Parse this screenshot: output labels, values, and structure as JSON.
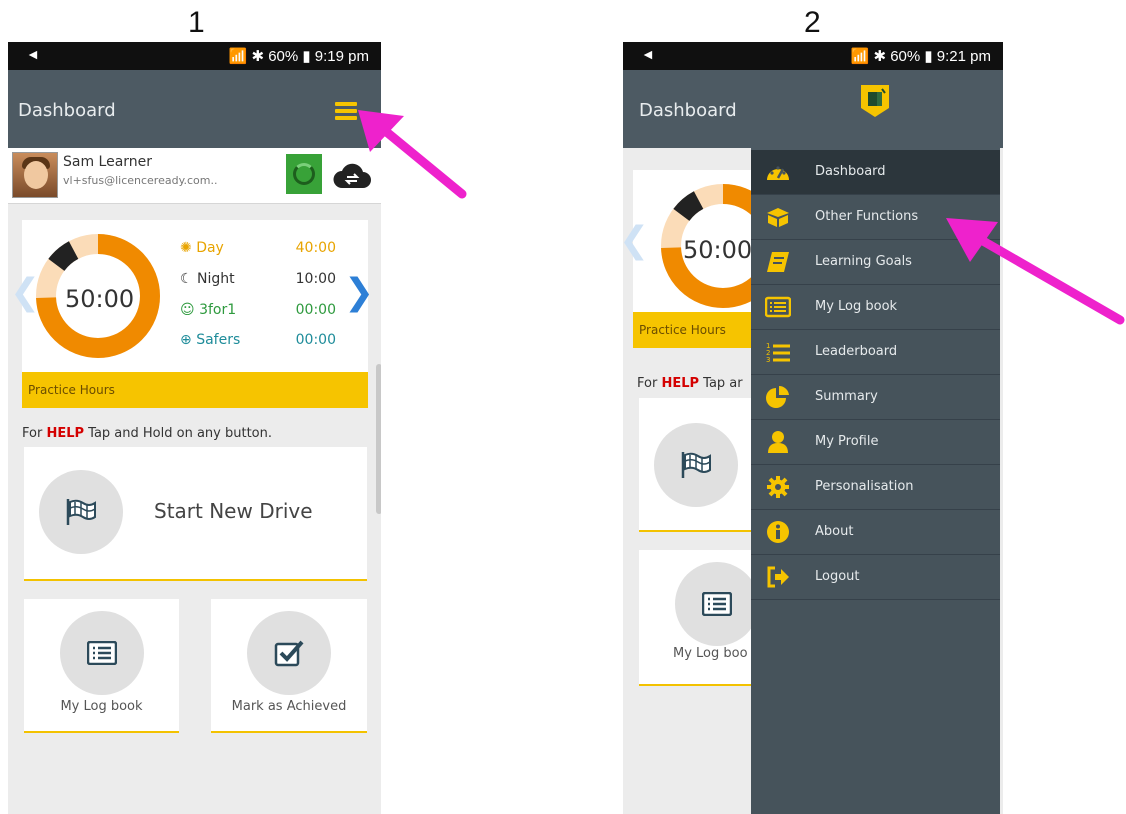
{
  "steps": {
    "first": "1",
    "second": "2"
  },
  "status_bar": {
    "left": "◄",
    "screen1_right": "📶 ✱ 60% ▮ 9:19 pm",
    "screen2_right": "📶 ✱ 60% ▮ 9:21 pm"
  },
  "header": {
    "title": "Dashboard"
  },
  "user": {
    "name": "Sam Learner",
    "email": "vl+sfus@licenceready.com.."
  },
  "hours": {
    "total": "50:00",
    "day_label": "Day",
    "day_value": "40:00",
    "night_label": "Night",
    "night_value": "10:00",
    "threefor1_label": "3for1",
    "threefor1_value": "00:00",
    "safers_label": "Safers",
    "safers_value": "00:00",
    "bar_label": "Practice Hours",
    "ring_fraction_day": 0.8,
    "ring_fraction_night": 0.2
  },
  "help": {
    "prefix": "For ",
    "keyword": "HELP",
    "suffix": " Tap and Hold on any button.",
    "short_suffix": " Tap ar"
  },
  "buttons": {
    "start_drive": "Start New Drive",
    "log_book": "My Log book",
    "log_book_cut": "My Log boo",
    "mark_achieved": "Mark as Achieved"
  },
  "drawer": {
    "items": [
      {
        "label": "Dashboard",
        "icon": "dashboard-icon"
      },
      {
        "label": "Other Functions",
        "icon": "box-icon"
      },
      {
        "label": "Learning Goals",
        "icon": "book-icon"
      },
      {
        "label": "My Log book",
        "icon": "log-book-icon"
      },
      {
        "label": "Leaderboard",
        "icon": "leaderboard-icon"
      },
      {
        "label": "Summary",
        "icon": "pie-chart-icon"
      },
      {
        "label": "My Profile",
        "icon": "user-icon"
      },
      {
        "label": "Personalisation",
        "icon": "gear-icon"
      },
      {
        "label": "About",
        "icon": "info-icon"
      },
      {
        "label": "Logout",
        "icon": "logout-icon"
      }
    ]
  },
  "colors": {
    "header": "#4d5a63",
    "drawer": "#46535b",
    "accent": "#f6c400",
    "arrow": "#ee22cc",
    "ring_day": "#f08a00",
    "ring_night": "#222222",
    "ring_empty": "#fbdcb8"
  }
}
